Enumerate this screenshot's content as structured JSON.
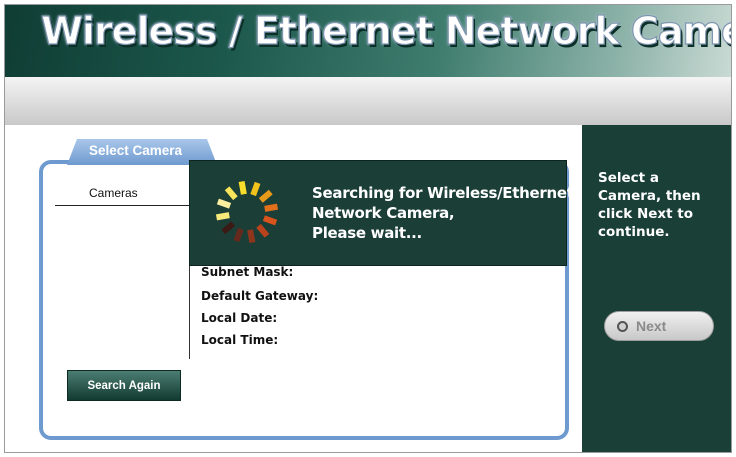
{
  "header": {
    "title": "Wireless / Ethernet  Network  Camera"
  },
  "panel": {
    "tab_label": "Select Camera",
    "cameras_header": "Cameras",
    "fields": [
      "Subnet Mask:",
      "Default Gateway:",
      "Local Date:",
      "Local Time:"
    ],
    "search_again_label": "Search Again"
  },
  "overlay": {
    "line1": "Searching for Wireless/Ethernet",
    "line2": "Network Camera,",
    "line3": "Please wait...",
    "icon": "loading-spinner-icon"
  },
  "sidebar": {
    "instruction": "Select a Camera, then click Next to continue.",
    "next_label": "Next"
  },
  "colors": {
    "dark_green": "#1a3f37",
    "panel_blue": "#6f9ad0",
    "spinner_yellow": "#f2d21a",
    "spinner_orange": "#d9541c"
  }
}
